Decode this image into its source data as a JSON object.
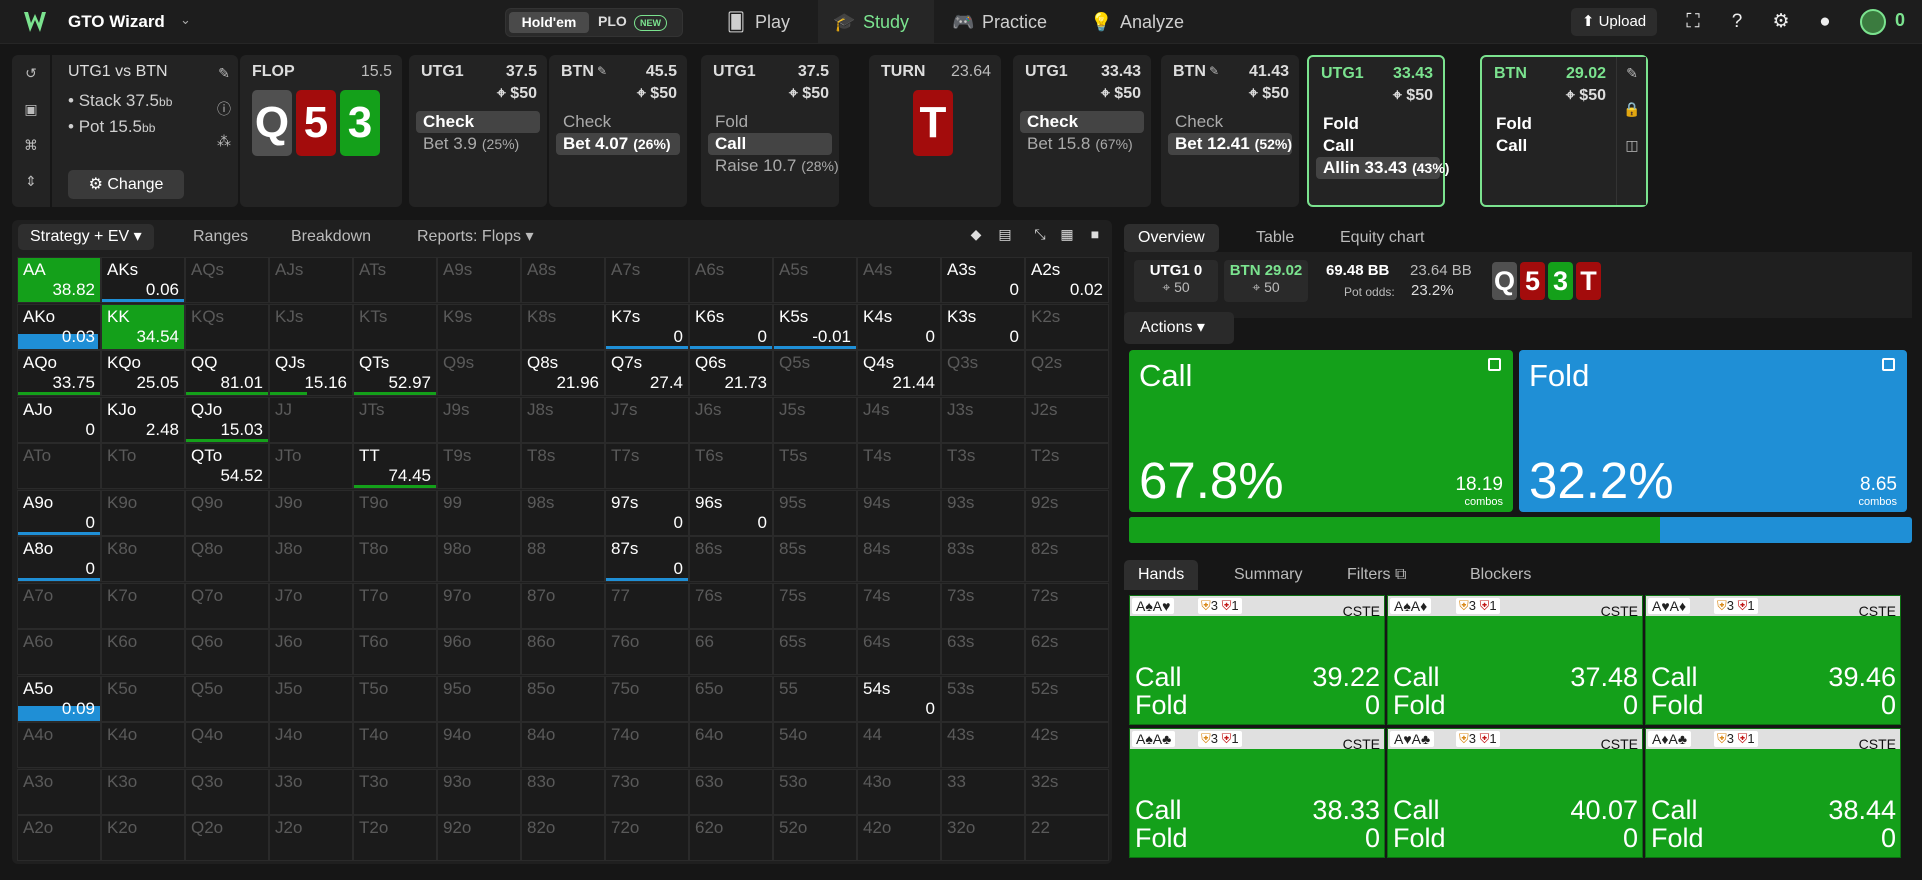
{
  "nav": {
    "app_name": "GTO Wizard",
    "holdem": "Hold'em",
    "plo": "PLO",
    "new_badge": "NEW",
    "tabs": [
      {
        "label": "Play",
        "icon": "cards-icon"
      },
      {
        "label": "Study",
        "icon": "graduation-cap-icon"
      },
      {
        "label": "Practice",
        "icon": "gamepad-icon"
      },
      {
        "label": "Analyze",
        "icon": "lightbulb-icon"
      }
    ],
    "upload": "Upload",
    "coins": "0"
  },
  "spot": {
    "title": "UTG1 vs BTN",
    "stack_label": "Stack 37.5",
    "pot_label": "Pot 15.5",
    "bb": "bb",
    "change": "Change"
  },
  "flop": {
    "label": "FLOP",
    "pot": "15.5",
    "cards": [
      {
        "rank": "Q",
        "suit": "spade"
      },
      {
        "rank": "5",
        "suit": "heart"
      },
      {
        "rank": "3",
        "suit": "club"
      }
    ]
  },
  "turn": {
    "label": "TURN",
    "pot": "23.64",
    "cards": [
      {
        "rank": "T",
        "suit": "heart"
      }
    ]
  },
  "actions": [
    {
      "pos": "UTG1",
      "stack": "37.5",
      "bet": "$50",
      "opts": [
        {
          "l": "Check",
          "p": "",
          "s": true
        },
        {
          "l": "Bet 3.9",
          "p": "(25%)",
          "s": false
        }
      ]
    },
    {
      "pos": "BTN",
      "stack": "45.5",
      "bet": "$50",
      "opts": [
        {
          "l": "Check",
          "p": "",
          "s": false
        },
        {
          "l": "Bet 4.07",
          "p": "(26%)",
          "s": true
        }
      ]
    },
    {
      "pos": "UTG1",
      "stack": "37.5",
      "bet": "$50",
      "opts": [
        {
          "l": "Fold",
          "p": "",
          "s": false
        },
        {
          "l": "Call",
          "p": "",
          "s": true
        },
        {
          "l": "Raise 10.7",
          "p": "(28%)",
          "s": false
        }
      ]
    },
    {
      "pos": "UTG1",
      "stack": "33.43",
      "bet": "$50",
      "opts": [
        {
          "l": "Check",
          "p": "",
          "s": true
        },
        {
          "l": "Bet 15.8",
          "p": "(67%)",
          "s": false
        }
      ]
    },
    {
      "pos": "BTN",
      "stack": "41.43",
      "bet": "$50",
      "opts": [
        {
          "l": "Check",
          "p": "",
          "s": false
        },
        {
          "l": "Bet 12.41",
          "p": "(52%)",
          "s": true
        }
      ]
    },
    {
      "pos": "UTG1",
      "stack": "33.43",
      "bet": "$50",
      "opts": [
        {
          "l": "Fold",
          "p": "",
          "s": false
        },
        {
          "l": "Call",
          "p": "",
          "s": false
        },
        {
          "l": "Allin 33.43",
          "p": "(43%)",
          "s": true
        }
      ]
    },
    {
      "pos": "BTN",
      "stack": "29.02",
      "bet": "$50",
      "opts": [
        {
          "l": "Fold",
          "p": "",
          "s": false
        },
        {
          "l": "Call",
          "p": "",
          "s": false
        }
      ]
    }
  ],
  "matrix_tabs": [
    "Strategy + EV",
    "Ranges",
    "Breakdown",
    "Reports: Flops"
  ],
  "matrix": {
    "ranks": [
      "A",
      "K",
      "Q",
      "J",
      "T",
      "9",
      "8",
      "7",
      "6",
      "5",
      "4",
      "3",
      "2"
    ],
    "cells": {
      "AA": {
        "v": "38.82",
        "g": 1.0
      },
      "AKs": {
        "v": "0.06",
        "b": 1.0
      },
      "A3s": {
        "v": "0"
      },
      "A2s": {
        "v": "0.02"
      },
      "AKo": {
        "v": "0.03",
        "g": 0.0,
        "fb": 0.98
      },
      "KK": {
        "v": "34.54",
        "g": 1.0
      },
      "K7s": {
        "v": "0",
        "b": 1.0
      },
      "K6s": {
        "v": "0",
        "b": 1.0
      },
      "K5s": {
        "v": "-0.01",
        "b": 1.0
      },
      "K4s": {
        "v": "0"
      },
      "K3s": {
        "v": "0"
      },
      "AQo": {
        "v": "33.75",
        "gb": 1.0
      },
      "KQo": {
        "v": "25.05"
      },
      "QQ": {
        "v": "81.01",
        "gb": 1.0
      },
      "QJs": {
        "v": "15.16",
        "gb": 0.45
      },
      "QTs": {
        "v": "52.97",
        "gb": 1.0
      },
      "Q8s": {
        "v": "21.96"
      },
      "Q7s": {
        "v": "27.4"
      },
      "Q6s": {
        "v": "21.73"
      },
      "Q4s": {
        "v": "21.44"
      },
      "AJo": {
        "v": "0"
      },
      "KJo": {
        "v": "2.48"
      },
      "QJo": {
        "v": "15.03",
        "gb": 1.0
      },
      "QTo": {
        "v": "54.52"
      },
      "TT": {
        "v": "74.45",
        "gb": 1.0
      },
      "A9o": {
        "v": "0",
        "b": 1.0
      },
      "97s": {
        "v": "0"
      },
      "96s": {
        "v": "0"
      },
      "A8o": {
        "v": "0",
        "b": 1.0
      },
      "87s": {
        "v": "0",
        "b": 1.0
      },
      "A5o": {
        "v": "0.09",
        "fb": 1.0,
        "g": 0.0
      },
      "54s": {
        "v": "0"
      }
    }
  },
  "overview_tabs": [
    "Overview",
    "Table",
    "Equity chart"
  ],
  "overview": {
    "p1": {
      "name": "UTG1",
      "stack": "0",
      "bet": "50"
    },
    "p2": {
      "name": "BTN",
      "stack": "29.02",
      "bet": "50"
    },
    "pot_bb": "69.48 BB",
    "call_bb": "23.64 BB",
    "pot_odds_label": "Pot odds:",
    "pot_odds": "23.2%",
    "board": [
      {
        "rank": "Q",
        "suit": "spade"
      },
      {
        "rank": "5",
        "suit": "heart"
      },
      {
        "rank": "3",
        "suit": "club"
      },
      {
        "rank": "T",
        "suit": "heart"
      }
    ]
  },
  "actions_btn": "Actions",
  "strategy": [
    {
      "name": "Call",
      "pct": "67.8%",
      "combos": "18.19",
      "color": "#14a01a",
      "frac": 0.678
    },
    {
      "name": "Fold",
      "pct": "32.2%",
      "combos": "8.65",
      "color": "#1f8fd6",
      "frac": 0.322
    }
  ],
  "combos_label": "combos",
  "hand_tabs": [
    "Hands",
    "Summary",
    "Filters",
    "Blockers"
  ],
  "hands": [
    {
      "c": "A♠A♥",
      "bl": "3",
      "bl2": "1",
      "cste": "CSTE",
      "call": "39.22",
      "fold": "0"
    },
    {
      "c": "A♠A♦",
      "bl": "3",
      "bl2": "1",
      "cste": "CSTE",
      "call": "37.48",
      "fold": "0"
    },
    {
      "c": "A♥A♦",
      "bl": "3",
      "bl2": "1",
      "cste": "CSTE",
      "call": "39.46",
      "fold": "0"
    },
    {
      "c": "A♠A♣",
      "bl": "3",
      "bl2": "1",
      "cste": "CSTE",
      "call": "38.33",
      "fold": "0"
    },
    {
      "c": "A♥A♣",
      "bl": "3",
      "bl2": "1",
      "cste": "CSTE",
      "call": "40.07",
      "fold": "0"
    },
    {
      "c": "A♦A♣",
      "bl": "3",
      "bl2": "1",
      "cste": "CSTE",
      "call": "38.44",
      "fold": "0"
    }
  ],
  "call_label": "Call",
  "fold_label": "Fold",
  "colors": {
    "accent": "#7be38f",
    "call": "#14a01a",
    "fold": "#1f8fd6",
    "heart": "#a30c0c",
    "spade": "#505050",
    "club": "#14a01a"
  }
}
